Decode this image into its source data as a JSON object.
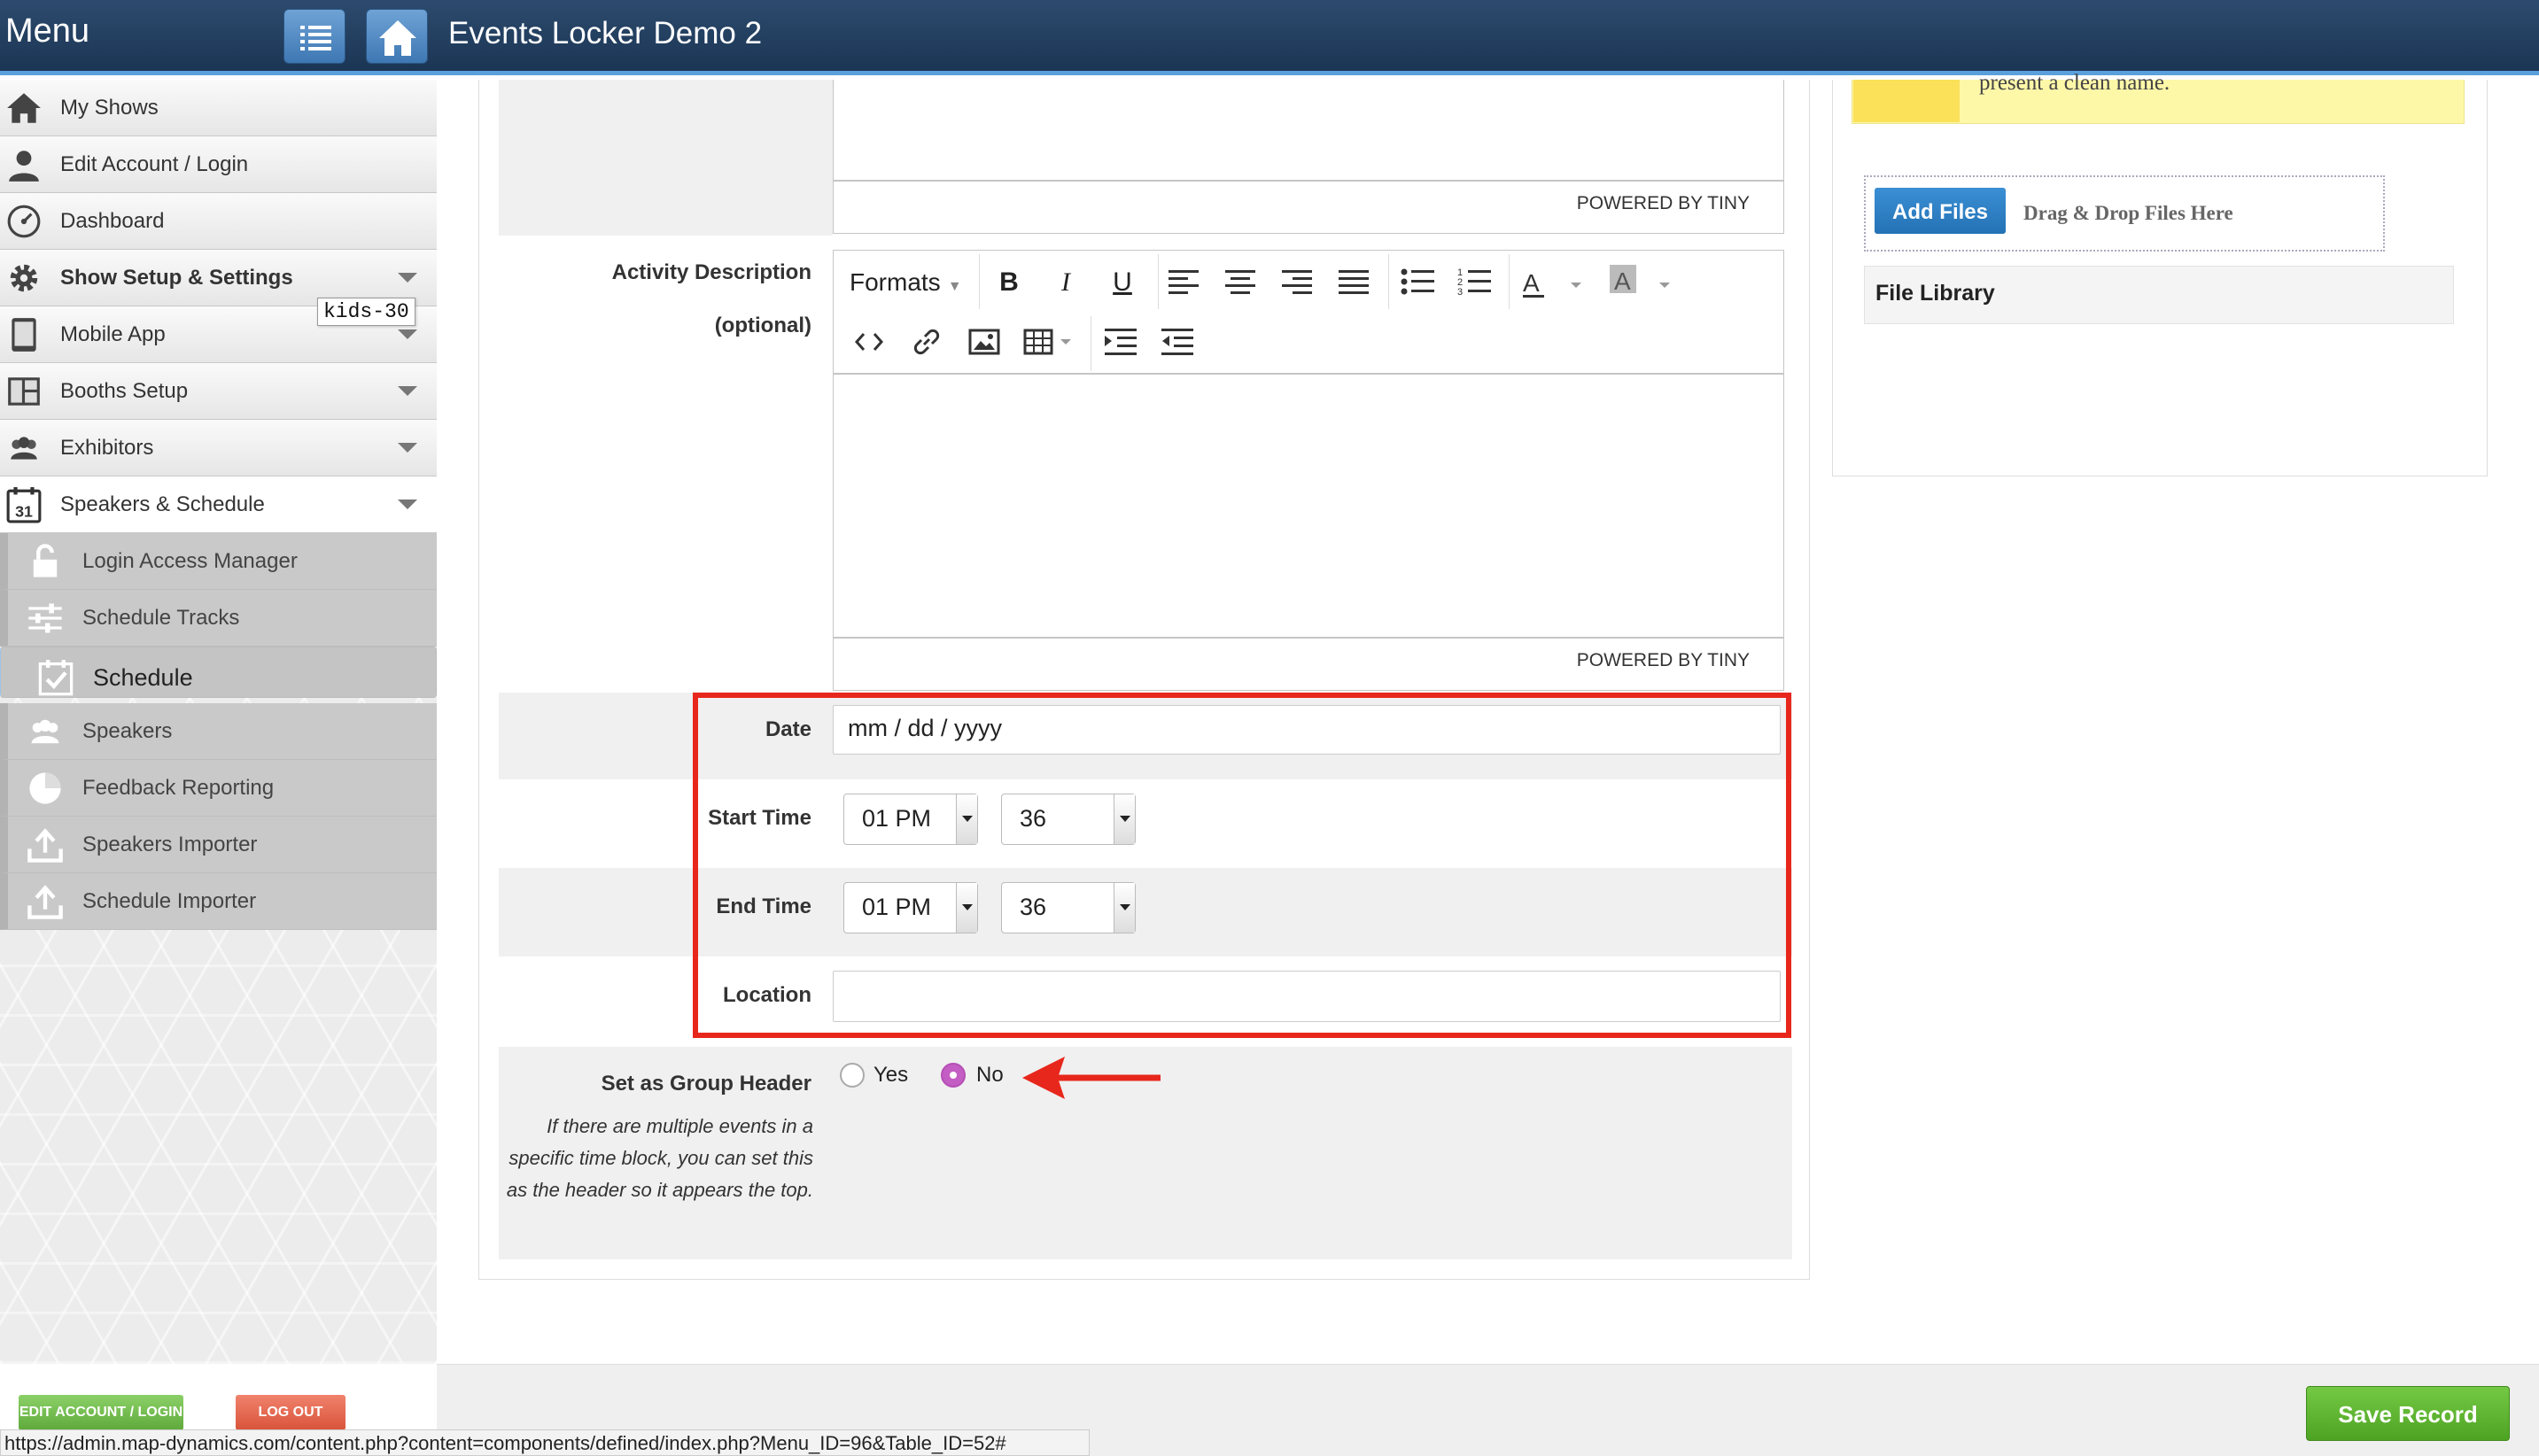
{
  "header": {
    "menu_label": "Menu",
    "app_title": "Events Locker Demo 2"
  },
  "sidebar": {
    "items": [
      {
        "label": "My Shows"
      },
      {
        "label": "Edit Account / Login"
      },
      {
        "label": "Dashboard"
      },
      {
        "label": "Show Setup & Settings"
      },
      {
        "label": "Mobile App"
      },
      {
        "label": "Booths Setup"
      },
      {
        "label": "Exhibitors"
      },
      {
        "label": "Speakers & Schedule"
      }
    ],
    "subitems": [
      {
        "label": "Login Access Manager"
      },
      {
        "label": "Schedule Tracks"
      },
      {
        "label": "Schedule"
      },
      {
        "label": "Speakers"
      },
      {
        "label": "Feedback Reporting"
      },
      {
        "label": "Speakers Importer"
      },
      {
        "label": "Schedule Importer"
      }
    ],
    "tooltip": "kids-30",
    "edit_account_button": "EDIT ACCOUNT / LOGIN",
    "logout_button": "LOG OUT"
  },
  "status_url": "https://admin.map-dynamics.com/content.php?content=components/defined/index.php?Menu_ID=96&Table_ID=52#",
  "form": {
    "powered_by": "POWERED BY TINY",
    "activity_label": "Activity Description",
    "optional_label": "(optional)",
    "formats_label": "Formats",
    "date_label": "Date",
    "date_placeholder": "mm / dd / yyyy",
    "start_time_label": "Start Time",
    "start_hour": "01 PM",
    "start_minute": "36",
    "end_time_label": "End Time",
    "end_hour": "01 PM",
    "end_minute": "36",
    "location_label": "Location",
    "location_value": "",
    "group_header_label": "Set as Group Header",
    "yes_label": "Yes",
    "no_label": "No",
    "group_header_selected": "No",
    "group_header_help": "If there are multiple events in a specific time block, you can set this as the header so it appears the top."
  },
  "right_panel": {
    "note_text": "present a clean name.",
    "add_files": "Add Files",
    "drag_drop": "Drag & Drop Files Here",
    "file_library": "File Library"
  },
  "save_button": "Save Record",
  "colors": {
    "header_bg": "#1f3a5c",
    "accent_blue": "#2f7fc1",
    "save_green": "#5cb531",
    "highlight_red": "#e8271c",
    "radio_selected": "#b54fb5"
  }
}
